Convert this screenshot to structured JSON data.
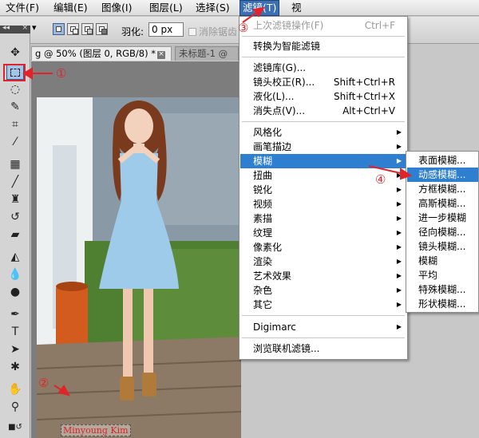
{
  "menubar": {
    "items": [
      "文件(F)",
      "编辑(E)",
      "图像(I)",
      "图层(L)",
      "选择(S)",
      "滤镜(T)",
      "视"
    ],
    "active_index": 5
  },
  "options_bar": {
    "feather_label": "羽化:",
    "feather_value": "0 px",
    "antialias_label": "消除锯齿"
  },
  "doc_tabs": {
    "active": "g @ 50% (图层 0, RGB/8) *",
    "inactive": "未标题-1 @"
  },
  "filter_menu": {
    "last_filter": {
      "label": "上次滤镜操作(F)",
      "shortcut": "Ctrl+F"
    },
    "smart_filter": "转换为智能滤镜",
    "gallery": "滤镜库(G)...",
    "lens_correction": {
      "label": "镜头校正(R)...",
      "shortcut": "Shift+Ctrl+R"
    },
    "liquify": {
      "label": "液化(L)...",
      "shortcut": "Shift+Ctrl+X"
    },
    "vanishing_point": {
      "label": "消失点(V)...",
      "shortcut": "Alt+Ctrl+V"
    },
    "submenus": [
      "风格化",
      "画笔描边",
      "模糊",
      "扭曲",
      "锐化",
      "视频",
      "素描",
      "纹理",
      "像素化",
      "渲染",
      "艺术效果",
      "杂色",
      "其它"
    ],
    "highlighted_submenu": "模糊",
    "digimarc": "Digimarc",
    "browse_online": "浏览联机滤镜..."
  },
  "blur_menu": {
    "items": [
      "表面模糊...",
      "动感模糊...",
      "方框模糊...",
      "高斯模糊...",
      "进一步模糊",
      "径向模糊...",
      "镜头模糊...",
      "模糊",
      "平均",
      "特殊模糊...",
      "形状模糊..."
    ],
    "highlighted": "动感模糊..."
  },
  "annotations": {
    "step1": "①",
    "step2": "②",
    "step3": "③",
    "step4": "④",
    "watermark": "Minyoung Kim"
  },
  "colors": {
    "annotation_red": "#e0242a",
    "menu_highlight": "#2f7fd1",
    "menubar_active": "#3b6fb6"
  },
  "toolbox_icons": [
    "move-icon",
    "rect-marquee-icon",
    "lasso-icon",
    "quick-select-icon",
    "crop-icon",
    "eyedropper-icon",
    "healing-brush-icon",
    "brush-icon",
    "clone-stamp-icon",
    "history-brush-icon",
    "eraser-icon",
    "paint-bucket-icon",
    "blur-icon",
    "dodge-icon",
    "pen-icon",
    "type-icon",
    "path-select-icon",
    "shape-icon",
    "hand-icon",
    "zoom-icon"
  ]
}
